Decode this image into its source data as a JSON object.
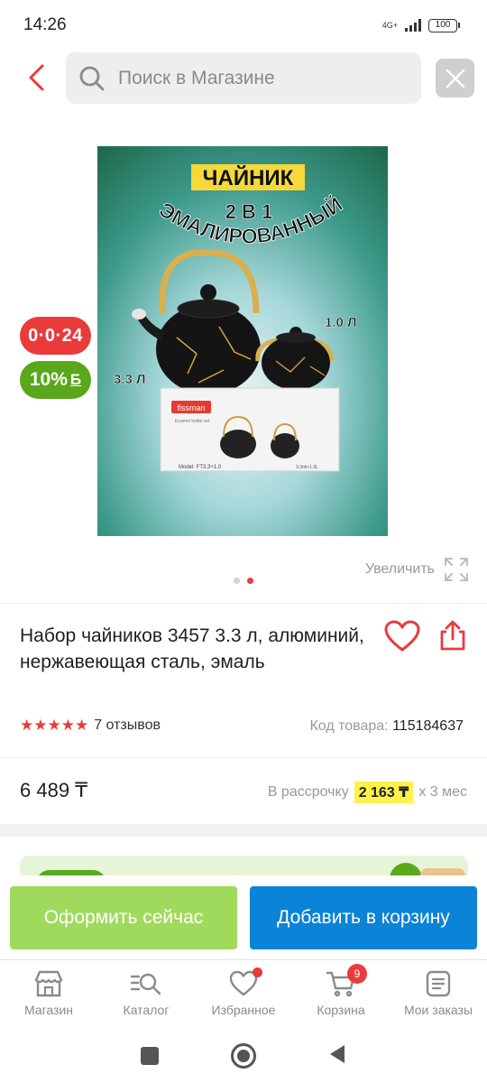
{
  "status_bar": {
    "time": "14:26",
    "network": "4G+",
    "battery": "100"
  },
  "header": {
    "search_placeholder": "Поиск в Магазине",
    "back_icon": "chevron-left-icon",
    "close_icon": "close-icon"
  },
  "image": {
    "title_line1": "ЧАЙНИК",
    "title_line2": "2 В 1",
    "title_line3": "ЭМАЛИРОВАННЫЙ",
    "volume_large": "3.3 Л",
    "volume_small": "1.0 Л",
    "box_brand": "fissman",
    "box_model": "Model: FT3.3+1.0",
    "box_text": "3.3ml+1.0L",
    "box_text_small": "Enamel kettle set"
  },
  "badges": {
    "timer": "0·0·24",
    "bonus": "10%",
    "bonus_currency": "Б"
  },
  "gallery": {
    "zoom_label": "Увеличить",
    "dots_total": 2,
    "dots_active": 2
  },
  "product": {
    "title": "Набор чайников 3457 3.3 л, алюминий, нержавеющая сталь, эмаль",
    "stars": "★★★★★",
    "rating": 5,
    "reviews": "7 отзывов",
    "sku_label": "Код товара: ",
    "sku_value": "115184637",
    "price": "6 489 ₸",
    "installment_label": "В рассрочку",
    "installment_amount": "2 163 ₸",
    "installment_term": "x 3 мес"
  },
  "actions": {
    "checkout": "Оформить сейчас",
    "add_to_cart": "Добавить в корзину"
  },
  "bottom_nav": {
    "items": [
      {
        "label": "Магазин",
        "icon": "store-icon"
      },
      {
        "label": "Каталог",
        "icon": "catalog-search-icon"
      },
      {
        "label": "Избранное",
        "icon": "heart-icon"
      },
      {
        "label": "Корзина",
        "icon": "cart-icon",
        "badge": "9"
      },
      {
        "label": "Мои заказы",
        "icon": "orders-list-icon"
      }
    ]
  },
  "colors": {
    "accent_red": "#ea3b3b",
    "checkout_green": "#a0da5d",
    "cart_blue": "#0a83d8",
    "bonus_green": "#59a71a",
    "installment_yellow": "#fff24d"
  }
}
